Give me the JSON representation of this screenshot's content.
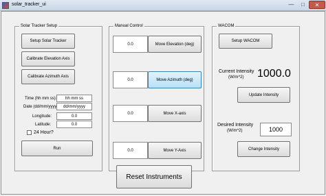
{
  "window": {
    "title": "solar_tracker_ui",
    "minimize": "—",
    "maximize": "□",
    "close": "✕"
  },
  "setup_panel": {
    "title": "Solar Tracker Setup",
    "setup_button": "Setup Solar Tracker",
    "cal_elev_button": "Calibrate Elevation Axis",
    "cal_azi_button": "Calibrate Azimuth Axis",
    "time_label": "Time (hh mm ss):",
    "time_value": "hh mm ss",
    "date_label": "Date (dd/mm/yyyy):",
    "date_value": "dd/mm/yyyy",
    "longitude_label": "Longitude:",
    "longitude_value": "0.0",
    "latitude_label": "Latitude:",
    "latitude_value": "0.0",
    "hour24_label": "24 Hour?",
    "run_button": "Run"
  },
  "manual_panel": {
    "title": "Manual Control",
    "rows": [
      {
        "value": "0.0",
        "button": "Move Elevation (deg)"
      },
      {
        "value": "0.0",
        "button": "Move Azimuth (deg)"
      },
      {
        "value": "0.0",
        "button": "Move X-axis"
      },
      {
        "value": "0.0",
        "button": "Move Y-Axis"
      }
    ]
  },
  "wacom_panel": {
    "title": "WACOM",
    "setup_button": "Setup WACOM",
    "current_label_1": "Current Intensity",
    "current_label_2": "(W/m^2)",
    "current_value": "1000.0",
    "update_button": "Update Intensity",
    "desired_label_1": "Desired Intensity",
    "desired_label_2": "(W/m^2)",
    "desired_value": "1000",
    "change_button": "Change Intensity"
  },
  "reset_button": "Reset Instruments"
}
